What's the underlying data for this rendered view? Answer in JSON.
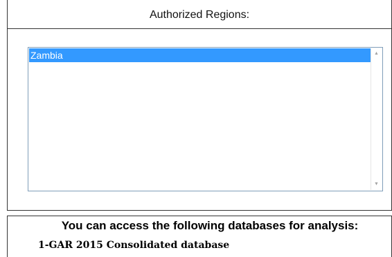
{
  "regions": {
    "title": "Authorized Regions:",
    "items": [
      {
        "label": "Zambia",
        "selected": true
      }
    ],
    "selected_color": "#3399ff"
  },
  "databases": {
    "heading": "You can access the following databases for analysis:",
    "items": [
      {
        "label": "1-GAR 2015 Consolidated database"
      }
    ]
  }
}
